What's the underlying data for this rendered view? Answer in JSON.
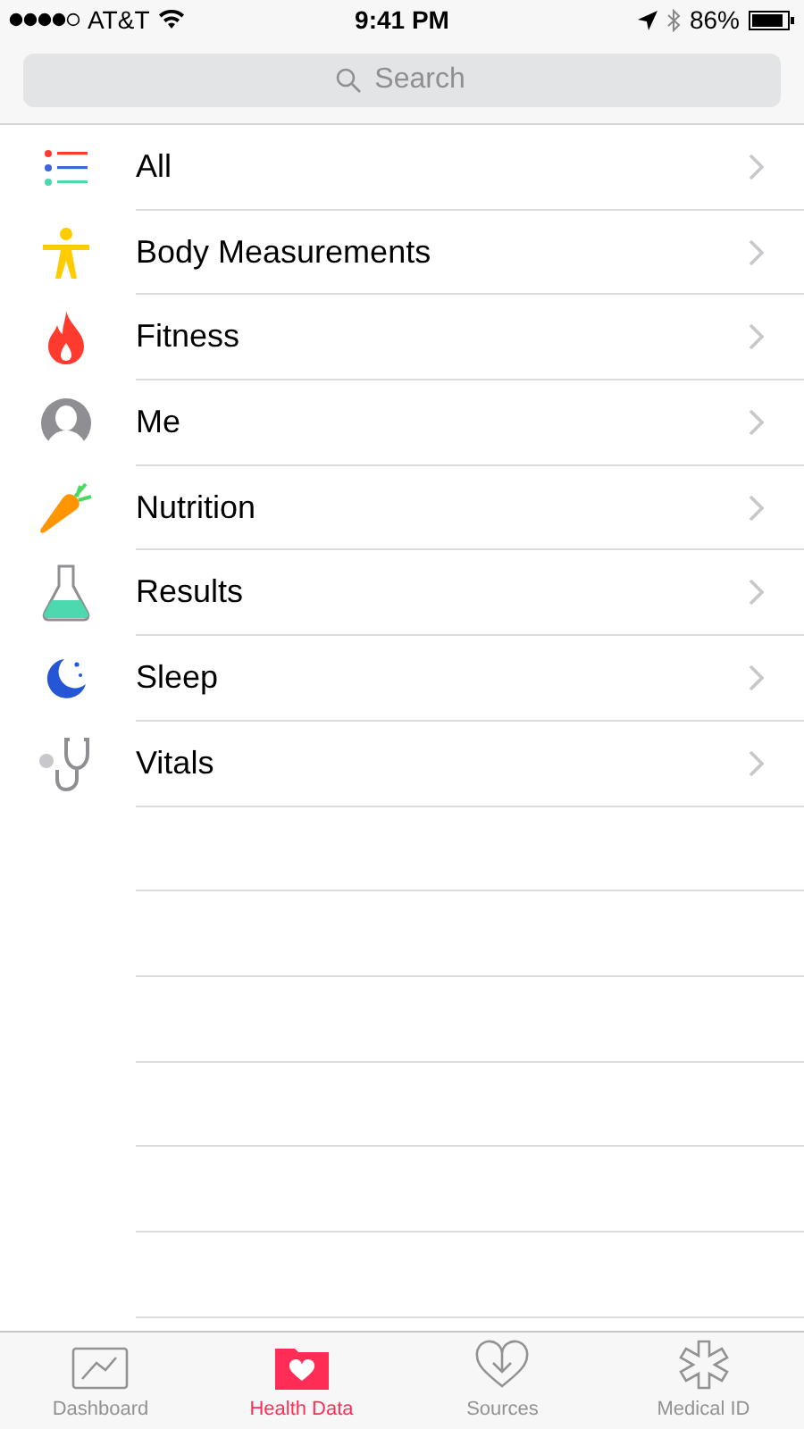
{
  "status_bar": {
    "carrier": "AT&T",
    "time": "9:41 PM",
    "battery": "86%"
  },
  "search": {
    "placeholder": "Search"
  },
  "categories": [
    {
      "label": "All"
    },
    {
      "label": "Body Measurements"
    },
    {
      "label": "Fitness"
    },
    {
      "label": "Me"
    },
    {
      "label": "Nutrition"
    },
    {
      "label": "Results"
    },
    {
      "label": "Sleep"
    },
    {
      "label": "Vitals"
    }
  ],
  "tabs": [
    {
      "label": "Dashboard",
      "selected": false
    },
    {
      "label": "Health Data",
      "selected": true
    },
    {
      "label": "Sources",
      "selected": false
    },
    {
      "label": "Medical ID",
      "selected": false
    }
  ]
}
